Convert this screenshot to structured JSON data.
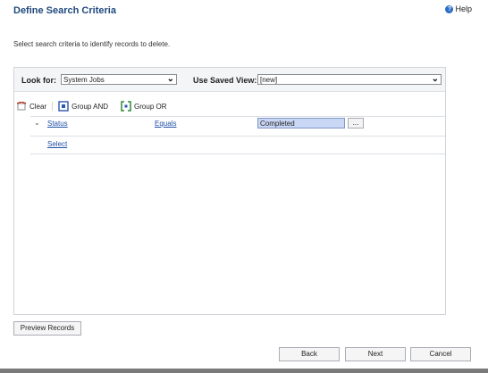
{
  "header": {
    "title": "Define Search Criteria",
    "help_label": "Help",
    "help_icon_glyph": "?"
  },
  "instructions": "Select search criteria to identify records to delete.",
  "lookup": {
    "look_for_label": "Look for:",
    "look_for_value": "System Jobs",
    "saved_view_label": "Use Saved View:",
    "saved_view_value": "[new]"
  },
  "toolbar": {
    "clear_label": "Clear",
    "group_and_label": "Group AND",
    "group_or_label": "Group OR"
  },
  "criteria": {
    "field": "Status",
    "operator": "Equals",
    "value": "Completed",
    "ellipsis": "...",
    "select_link": "Select"
  },
  "buttons": {
    "preview": "Preview Records",
    "back": "Back",
    "next": "Next",
    "cancel": "Cancel"
  },
  "colors": {
    "title": "#1f497d",
    "link": "#1f4fa6",
    "value_highlight": "#c9d7f5"
  }
}
